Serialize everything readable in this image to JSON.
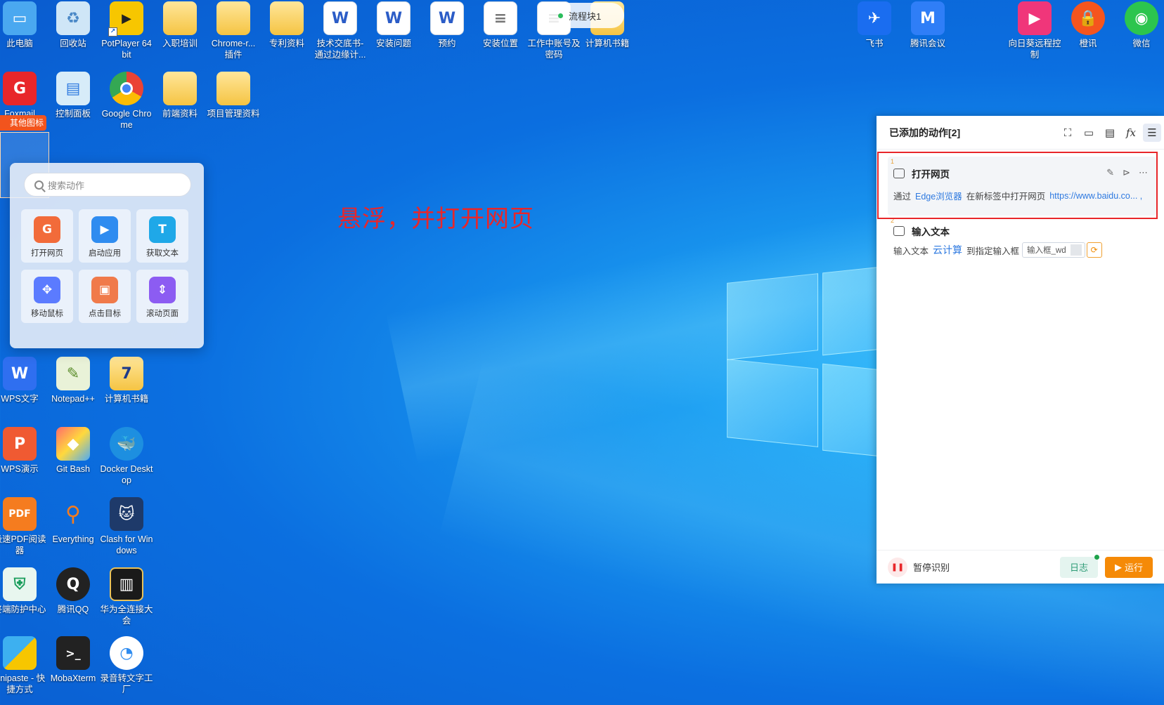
{
  "desktop": {
    "top_row": [
      {
        "label": "此电脑",
        "icon": "computer-icon"
      },
      {
        "label": "回收站",
        "icon": "recycle-bin-icon"
      },
      {
        "label": "PotPlayer 64 bit",
        "icon": "potplayer-icon"
      },
      {
        "label": "入职培训",
        "icon": "folder-icon"
      },
      {
        "label": "Chrome-r... 插件",
        "icon": "folder-icon"
      },
      {
        "label": "专利资料",
        "icon": "folder-icon"
      },
      {
        "label": "技术交底书-通过边缘计...",
        "icon": "word-doc-icon"
      },
      {
        "label": "安装问题",
        "icon": "word-doc-icon"
      },
      {
        "label": "预约",
        "icon": "word-doc-icon"
      },
      {
        "label": "安装位置",
        "icon": "text-doc-icon"
      },
      {
        "label": "工作中账号及密码",
        "icon": "text-doc-icon"
      },
      {
        "label": "计算机书籍",
        "icon": "folder-icon"
      }
    ],
    "right_top": [
      {
        "label": "飞书",
        "icon": "feishu-icon"
      },
      {
        "label": "腾讯会议",
        "icon": "tencent-meeting-icon"
      },
      {
        "label": "向日葵远程控制",
        "icon": "sunflower-icon"
      },
      {
        "label": "橙讯",
        "icon": "lock-app-icon"
      },
      {
        "label": "微信",
        "icon": "wechat-icon"
      }
    ],
    "row2": [
      {
        "label": "Foxmail",
        "icon": "foxmail-icon"
      },
      {
        "label": "控制面板",
        "icon": "control-panel-icon"
      },
      {
        "label": "Google Chrome",
        "icon": "chrome-icon"
      },
      {
        "label": "前端资料",
        "icon": "folder-icon"
      },
      {
        "label": "项目管理资料",
        "icon": "folder-icon"
      }
    ],
    "other_icons_tag": "其他图标",
    "left_column": [
      {
        "label": "WPS文字",
        "icon": "wps-writer-icon"
      },
      {
        "label": "Notepad++",
        "icon": "notepad-icon"
      },
      {
        "label": "计算机书籍",
        "icon": "book-folder-icon"
      },
      {
        "label": "WPS演示",
        "icon": "wps-presentation-icon"
      },
      {
        "label": "Git Bash",
        "icon": "git-icon"
      },
      {
        "label": "Docker Desktop",
        "icon": "docker-icon"
      },
      {
        "label": "极速PDF阅读器",
        "icon": "pdf-icon"
      },
      {
        "label": "Everything",
        "icon": "search-app-icon"
      },
      {
        "label": "Clash for Windows",
        "icon": "clash-icon"
      },
      {
        "label": "终端防护中心",
        "icon": "shield-icon"
      },
      {
        "label": "腾讯QQ",
        "icon": "qq-icon"
      },
      {
        "label": "华为全连接大会",
        "icon": "book-icon"
      },
      {
        "label": "Snipaste - 快捷方式",
        "icon": "snipaste-icon"
      },
      {
        "label": "MobaXterm",
        "icon": "terminal-icon"
      },
      {
        "label": "录音转文字工厂",
        "icon": "recorder-icon"
      }
    ]
  },
  "float_pill": {
    "label": "流程块1"
  },
  "popup": {
    "search_placeholder": "搜索动作",
    "actions": [
      {
        "label": "打开网页",
        "color": "#f26b3a"
      },
      {
        "label": "启动应用",
        "color": "#2f8cf0"
      },
      {
        "label": "获取文本",
        "color": "#1fa8e8"
      },
      {
        "label": "移动鼠标",
        "color": "#5b7bff"
      },
      {
        "label": "点击目标",
        "color": "#f07a4a"
      },
      {
        "label": "滚动页面",
        "color": "#8c5cf2"
      }
    ]
  },
  "annotation": "悬浮，并打开网页",
  "panel": {
    "title": "已添加的动作[2]",
    "steps": [
      {
        "num": "1",
        "title": "打开网页",
        "desc_prefix": "通过",
        "browser": "Edge浏览器",
        "desc_mid": "在新标签中打开网页",
        "url": "https://www.baidu.co... ,"
      },
      {
        "num": "2",
        "title": "输入文本",
        "desc_prefix": "输入文本",
        "text_value": "云计算",
        "desc_mid": "到指定输入框",
        "input_box": "输入框_wd"
      }
    ],
    "footer": {
      "pause_label": "暂停识别",
      "log_label": "日志",
      "run_label": "运行"
    }
  }
}
